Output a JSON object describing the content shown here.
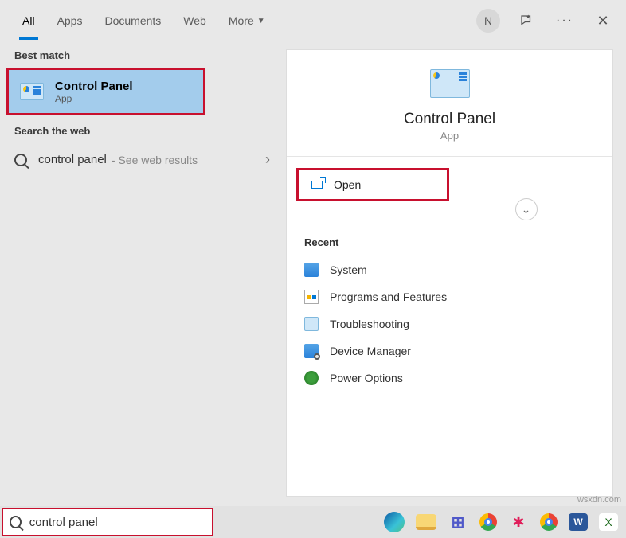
{
  "header": {
    "tabs": [
      "All",
      "Apps",
      "Documents",
      "Web",
      "More"
    ],
    "active_tab": 0,
    "avatar_initial": "N"
  },
  "left": {
    "best_match_header": "Best match",
    "best_match": {
      "title": "Control Panel",
      "subtitle": "App"
    },
    "search_web_header": "Search the web",
    "web_result": {
      "query": "control panel",
      "hint": "- See web results"
    }
  },
  "right": {
    "hero": {
      "title": "Control Panel",
      "subtitle": "App"
    },
    "open_label": "Open",
    "recent_header": "Recent",
    "recent": [
      "System",
      "Programs and Features",
      "Troubleshooting",
      "Device Manager",
      "Power Options"
    ]
  },
  "search": {
    "value": "control panel"
  },
  "watermark": "wsxdn.com"
}
